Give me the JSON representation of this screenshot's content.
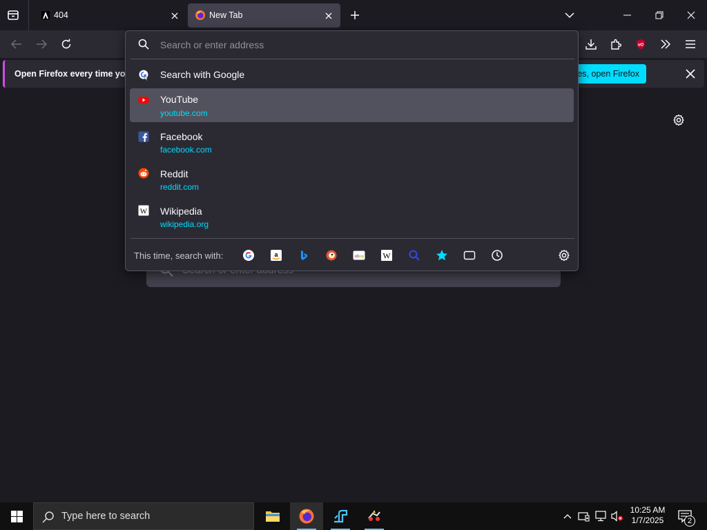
{
  "tabs": [
    {
      "title": "404",
      "active": false
    },
    {
      "title": "New Tab",
      "active": true
    }
  ],
  "notification": {
    "text": "Open Firefox every time you",
    "button": "es, open Firefox"
  },
  "urlbar": {
    "placeholder": "Search or enter address",
    "search_suggestion": "Search with Google",
    "results": [
      {
        "title": "YouTube",
        "url": "youtube.com",
        "icon": "youtube-icon",
        "selected": true
      },
      {
        "title": "Facebook",
        "url": "facebook.com",
        "icon": "facebook-icon",
        "selected": false
      },
      {
        "title": "Reddit",
        "url": "reddit.com",
        "icon": "reddit-icon",
        "selected": false
      },
      {
        "title": "Wikipedia",
        "url": "wikipedia.org",
        "icon": "wikipedia-icon",
        "selected": false
      }
    ],
    "oneoff_label": "This time, search with:",
    "oneoff_engines": [
      "google-icon",
      "amazon-icon",
      "bing-icon",
      "duckduckgo-icon",
      "ebay-icon",
      "wikipedia-icon",
      "search-icon",
      "bookmarks-icon",
      "tabs-icon",
      "history-icon",
      "settings-icon"
    ]
  },
  "newtab": {
    "search_placeholder": "Search or enter address"
  },
  "taskbar": {
    "search_placeholder": "Type here to search",
    "time": "10:25 AM",
    "date": "1/7/2025",
    "notification_count": "2"
  },
  "colors": {
    "accent": "#00ddff",
    "notification_border": "#d14de6",
    "background": "#1c1b22"
  }
}
